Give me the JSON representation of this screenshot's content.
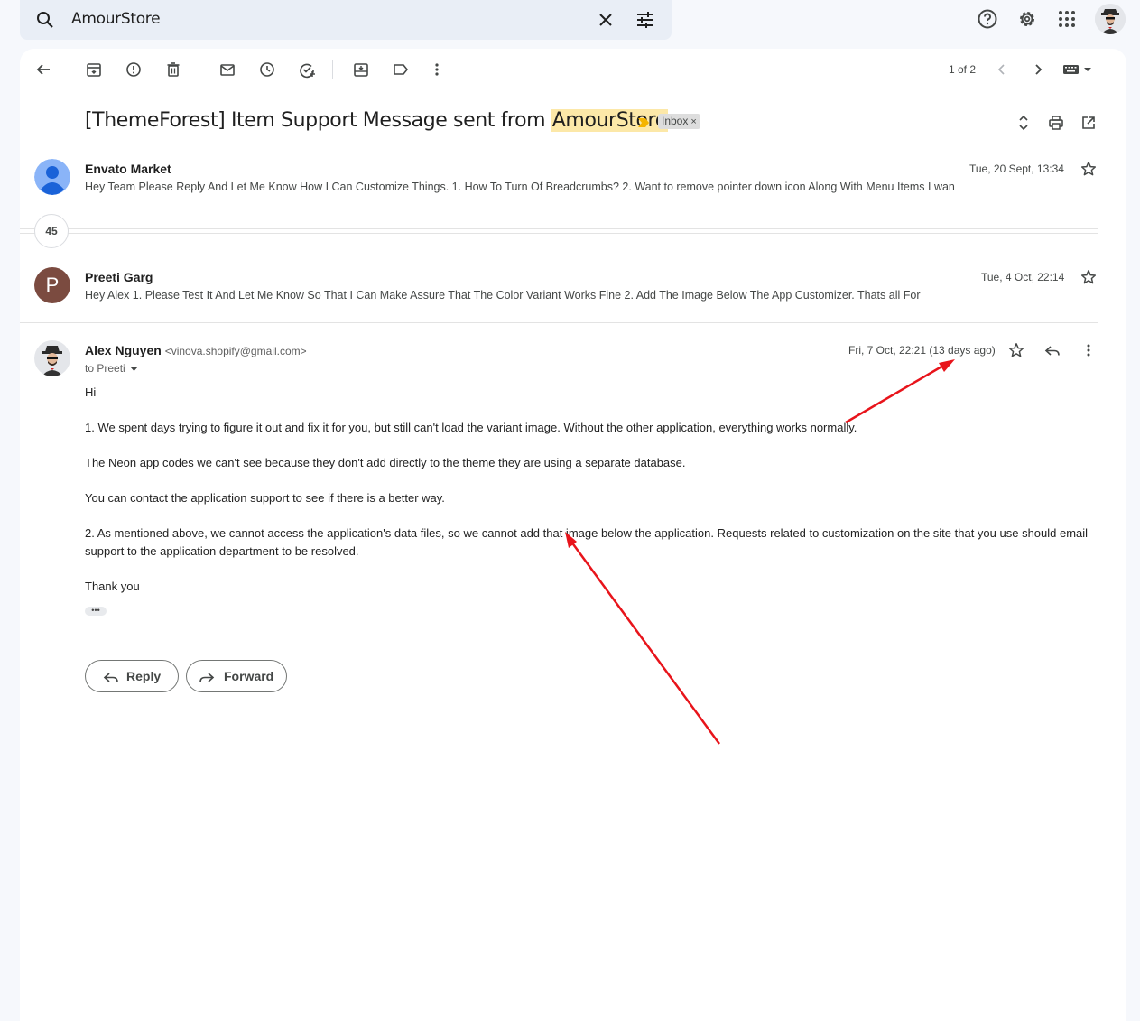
{
  "search": {
    "query": "AmourStore"
  },
  "toolbar": {
    "pager": "1 of 2"
  },
  "thread": {
    "subject_prefix": "[ThemeForest] Item Support Message sent from ",
    "subject_highlight": "AmourStore",
    "label": "Inbox",
    "label_remove": "×",
    "collapsed_count": "45"
  },
  "messages": [
    {
      "sender": "Envato Market",
      "snippet": "Hey Team Please Reply And Let Me Know How I Can Customize Things. 1. How To Turn Of Breadcrumbs? 2. Want to remove pointer down icon Along With Menu Items I wan",
      "date": "Tue, 20 Sept, 13:34"
    },
    {
      "sender": "Preeti Garg",
      "avatar_letter": "P",
      "snippet": "Hey Alex 1. Please Test It And Let Me Know So That I Can Make Assure That The Color Variant Works Fine 2. Add The Image Below The App Customizer. Thats all For",
      "date": "Tue, 4 Oct, 22:14"
    }
  ],
  "open_message": {
    "sender": "Alex Nguyen",
    "email": "<vinova.shopify@gmail.com>",
    "to": "to Preeti",
    "date": "Fri, 7 Oct, 22:21 (13 days ago)",
    "greeting": "Hi",
    "p1": "1. We spent days trying to figure it out and fix it for you, but still can't load the variant image. Without the other application, everything works normally.",
    "p2": "The Neon app codes we can't see because they don't add directly to the theme they are using a separate database.",
    "p3": "You can contact the application support to see if there is a better way.",
    "p4": "2. As mentioned above, we cannot access the application's data files, so we cannot add that image below the application. Requests related to customization on the site that you use should email support to the application department to be resolved.",
    "closing": "Thank you",
    "trimmed": "•••"
  },
  "actions": {
    "reply": "Reply",
    "forward": "Forward"
  },
  "colors": {
    "annotation_arrow": "#e8141b",
    "highlight": "#fce8a8",
    "importance": "#f4b400"
  }
}
